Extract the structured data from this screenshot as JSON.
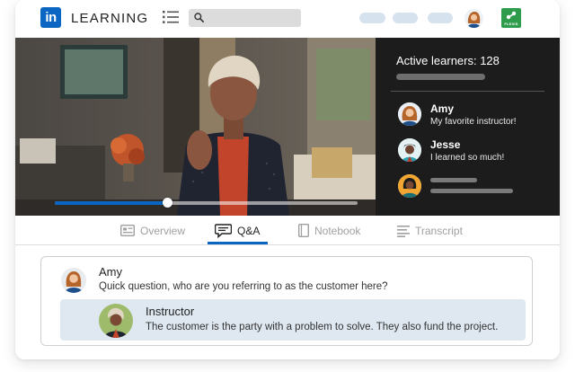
{
  "header": {
    "logo_text": "in",
    "title": "LEARNING",
    "search": {
      "placeholder": ""
    },
    "badge_text": "FLEXIS",
    "icons": [
      "menu-icon",
      "search-icon",
      "flexis-icon"
    ]
  },
  "video": {
    "progress": 0.37
  },
  "learners_panel": {
    "active_learners": "Active learners: 128",
    "comments": [
      {
        "name": "Amy",
        "message": "My favorite instructor!"
      },
      {
        "name": "Jesse",
        "message": "I learned so much!"
      }
    ]
  },
  "tabs": [
    {
      "label": "Overview",
      "icon": "overview-icon",
      "active": false
    },
    {
      "label": "Q&A",
      "icon": "chat-icon",
      "active": true
    },
    {
      "label": "Notebook",
      "icon": "notebook-icon",
      "active": false
    },
    {
      "label": "Transcript",
      "icon": "transcript-icon",
      "active": false
    }
  ],
  "qa": {
    "question": {
      "name": "Amy",
      "text": "Quick question, who are you referring to as the customer here?"
    },
    "answer": {
      "name": "Instructor",
      "text": "The customer is the party with a problem to solve. They also fund the project."
    }
  },
  "colors": {
    "brand": "#0a66c2",
    "panel_bg": "#1c1c1c",
    "answer_bg": "#dfe8f1",
    "badge": "#2e9c4a"
  }
}
